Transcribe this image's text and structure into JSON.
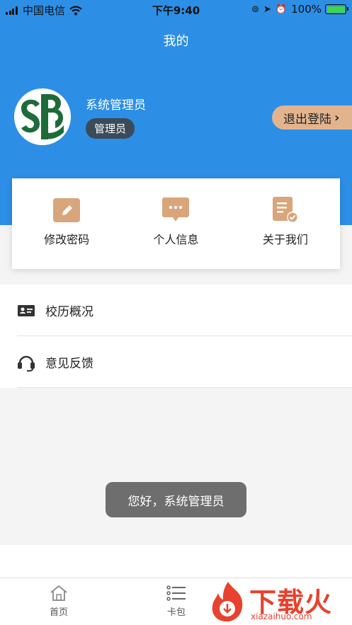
{
  "status_bar": {
    "carrier": "中国电信",
    "time": "下午9:40",
    "battery_percent": "100%",
    "battery_level": 1.0
  },
  "nav": {
    "title": "我的"
  },
  "profile": {
    "name": "系统管理员",
    "role": "管理员",
    "logout_label": "退出登陆"
  },
  "quick_actions": [
    {
      "label": "修改密码",
      "icon": "pencil-icon"
    },
    {
      "label": "个人信息",
      "icon": "chat-bubble-icon"
    },
    {
      "label": "关于我们",
      "icon": "document-check-icon"
    }
  ],
  "menu": [
    {
      "label": "校历概况",
      "icon": "id-card-icon"
    },
    {
      "label": "意见反馈",
      "icon": "headset-icon"
    }
  ],
  "toast": {
    "text": "您好，系统管理员"
  },
  "tabs": [
    {
      "label": "首页",
      "icon": "home-icon"
    },
    {
      "label": "卡包",
      "icon": "list-icon"
    }
  ],
  "watermark": {
    "brand": "下载火",
    "site": "xiazaihuo.com"
  },
  "colors": {
    "header_blue": "#2d8ee6",
    "accent_tan": "#d9a57a",
    "badge_dark": "#3c4b5a",
    "logo_green": "#1e6b3a",
    "watermark_red": "#e8412e"
  }
}
